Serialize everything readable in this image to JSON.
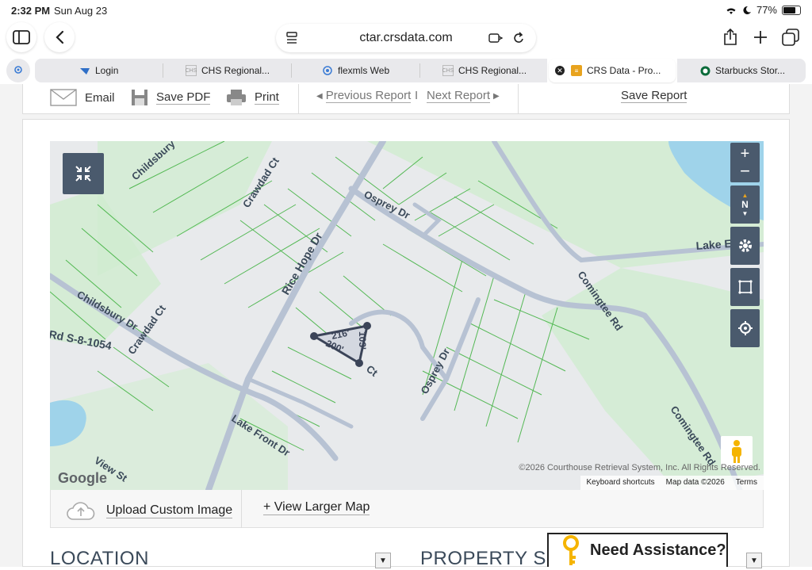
{
  "status": {
    "time": "2:32 PM",
    "date": "Sun Aug 23",
    "battery": "77%",
    "battery_level": 0.77
  },
  "browser": {
    "url": "ctar.crsdata.com"
  },
  "tabs": [
    {
      "label": "Login",
      "icon": "bird-icon"
    },
    {
      "label": "CHS Regional...",
      "icon": "chs-mls-icon"
    },
    {
      "label": "flexmls Web",
      "icon": "flexmls-icon"
    },
    {
      "label": "CHS Regional...",
      "icon": "chs-mls-icon"
    },
    {
      "label": "CRS Data - Pro...",
      "icon": "crs-icon",
      "active": true
    },
    {
      "label": "Starbucks Stor...",
      "icon": "starbucks-icon"
    }
  ],
  "report_toolbar": {
    "email": "Email",
    "save_pdf": "Save PDF",
    "print": "Print",
    "previous": "Previous Report",
    "divider": "I",
    "next": "Next Report",
    "save_report": "Save Report"
  },
  "map": {
    "streets": [
      "Childsbury",
      "Crawdad Ct",
      "Osprey Dr",
      "Lake E",
      "Rice Hope Dr",
      "Comingtee Rd",
      "Childsbury Dr",
      "Crawdad Ct",
      "Rd S-8-1054",
      "Osprey Dr",
      "Lake Front Dr",
      "View St",
      "Comingtee Rd",
      "Ct"
    ],
    "lot_labels": [
      "216'",
      "200'",
      "103'"
    ],
    "credit": "©2026 Courthouse Retrieval System, Inc. All Rights Reserved.",
    "google": "Google",
    "footer": {
      "keyboard": "Keyboard shortcuts",
      "mapdata": "Map data ©2026",
      "terms": "Terms"
    },
    "compass": "N"
  },
  "image_bar": {
    "upload": "Upload Custom Image",
    "view_larger": "+ View Larger Map"
  },
  "sections": {
    "location": "LOCATION",
    "property": "PROPERTY SU"
  },
  "assist": {
    "label": "Need Assistance?"
  }
}
